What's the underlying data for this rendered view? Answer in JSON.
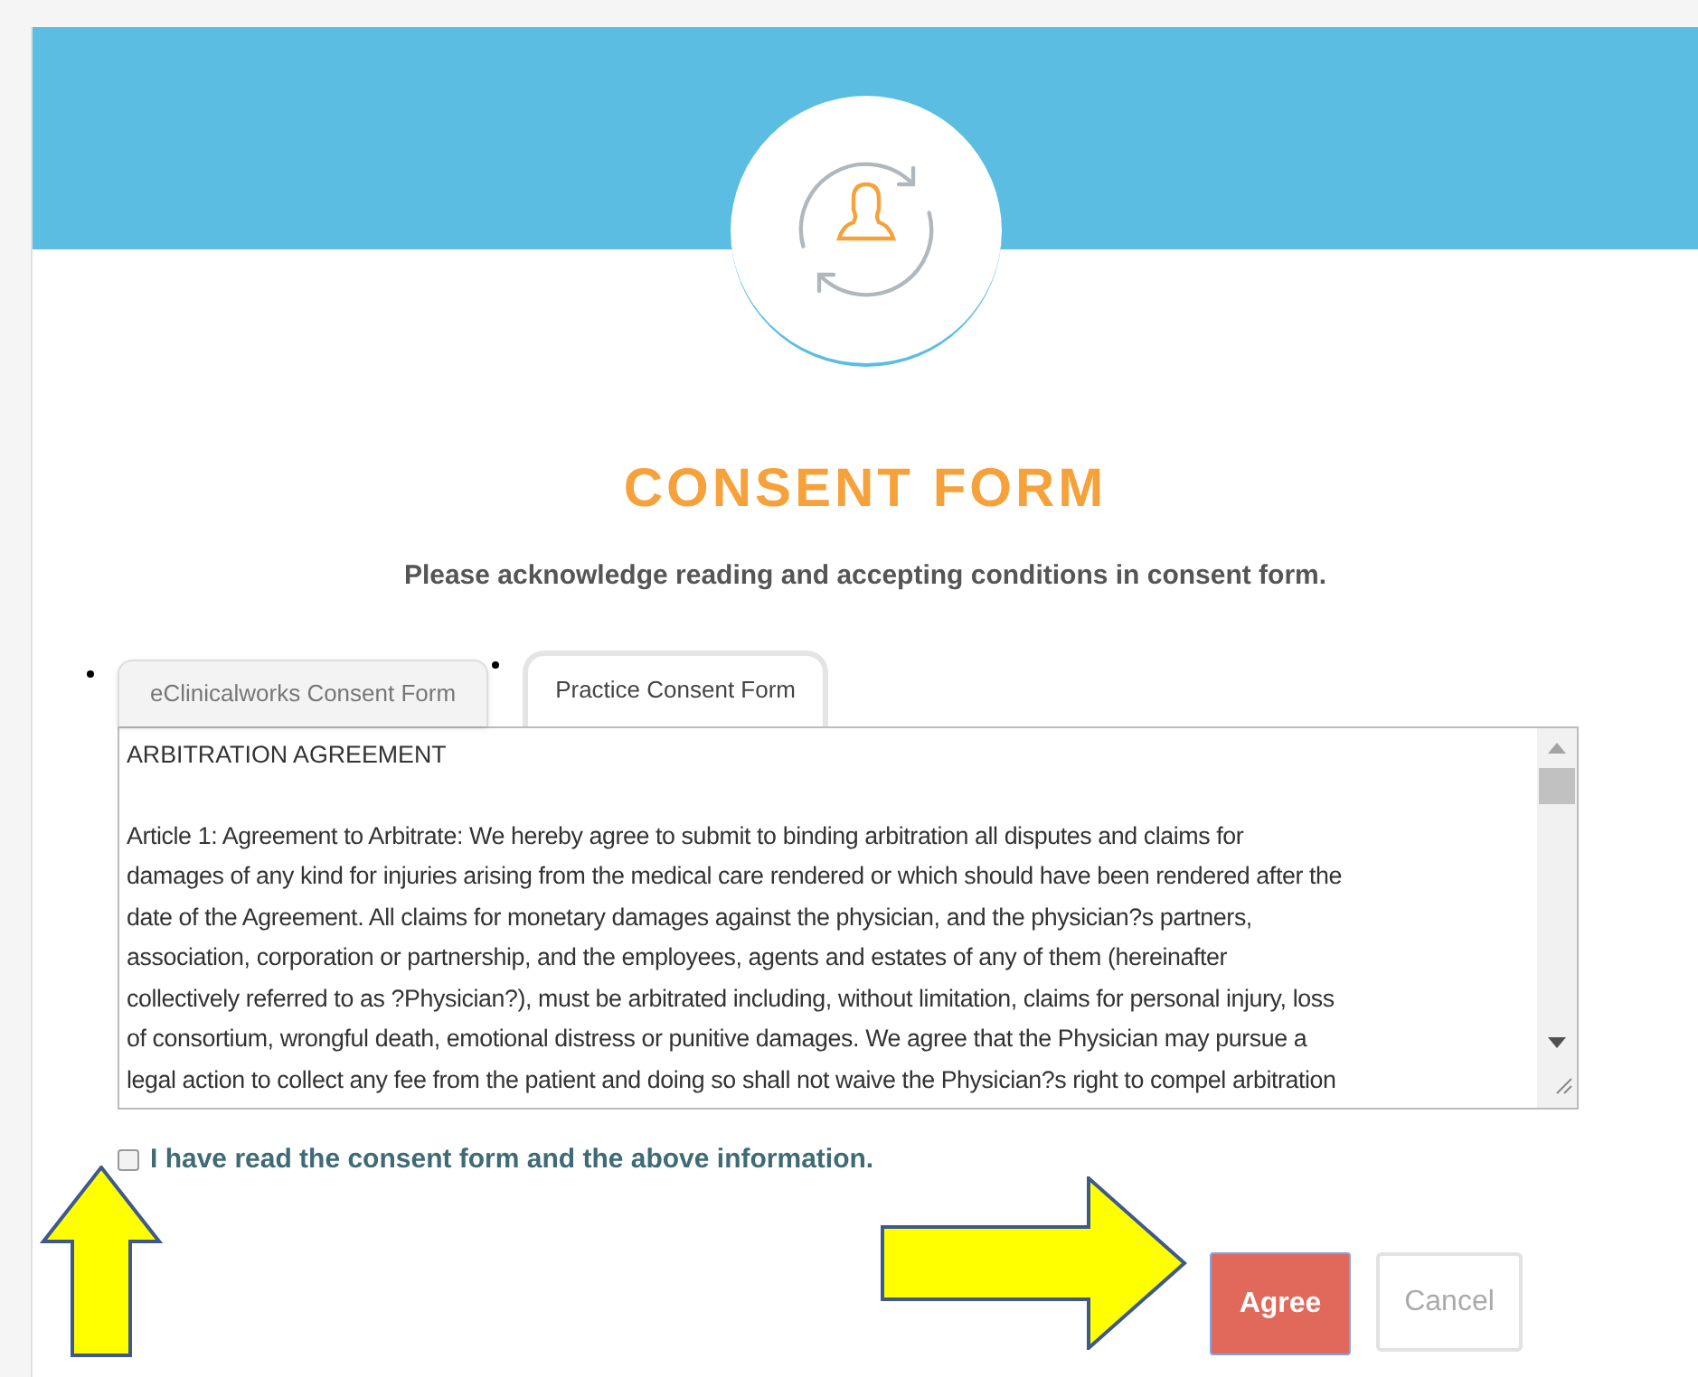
{
  "header": {
    "title": "CONSENT FORM",
    "subtitle": "Please acknowledge reading and accepting conditions in consent form."
  },
  "tabs": [
    {
      "label": "eClinicalworks Consent Form",
      "selected": false
    },
    {
      "label": "Practice Consent Form",
      "selected": true
    }
  ],
  "document": {
    "heading": "ARBITRATION AGREEMENT",
    "lines": [
      "Article 1: Agreement to Arbitrate: We hereby agree to submit to binding arbitration all disputes and claims for",
      "damages of any kind for injuries arising from the medical care rendered or which should have been rendered after the",
      "date of the Agreement. All claims for monetary damages against the physician, and the physician?s partners,",
      "association, corporation or partnership, and the employees, agents and estates of any of them (hereinafter",
      "collectively referred to as ?Physician?), must be arbitrated including, without limitation, claims for personal injury, loss",
      "of consortium, wrongful death, emotional distress or punitive damages. We agree that the Physician may pursue a",
      "legal action to collect any fee from the patient and doing so shall not waive the Physician?s right to compel arbitration"
    ]
  },
  "acknowledge": {
    "label": "I have read the consent form and the above information.",
    "checked": false
  },
  "buttons": [
    {
      "label": "Agree",
      "kind": "primary"
    },
    {
      "label": "Cancel",
      "kind": "secondary"
    }
  ]
}
